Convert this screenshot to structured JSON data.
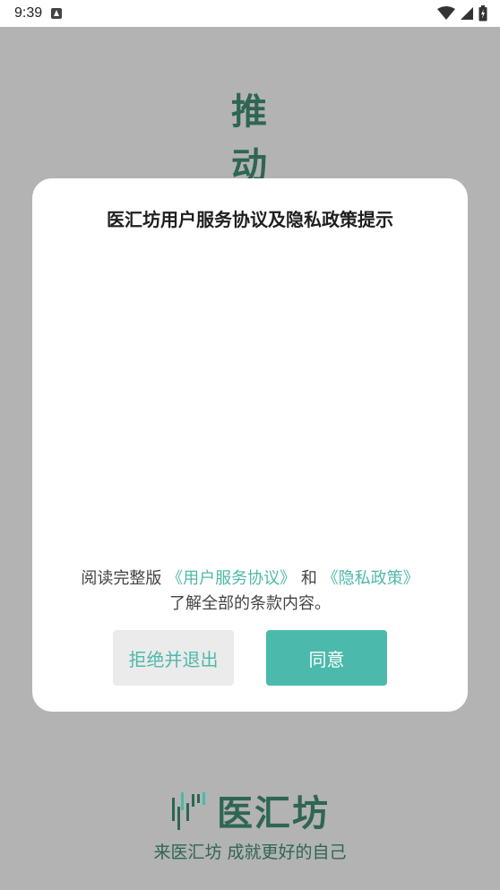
{
  "status_bar": {
    "time": "9:39"
  },
  "background": {
    "calligraphy": [
      "推",
      "动"
    ]
  },
  "dialog": {
    "title": "医汇坊用户服务协议及隐私政策提示",
    "read_prefix": "阅读完整版",
    "user_agreement_link": "《用户服务协议》",
    "and_text": "和",
    "privacy_link": "《隐私政策》",
    "read_suffix": "了解全部的条款内容。",
    "refuse_button": "拒绝并退出",
    "agree_button": "同意"
  },
  "brand": {
    "name": "医汇坊",
    "slogan": "来医汇坊 成就更好的自己"
  },
  "colors": {
    "accent": "#4bb9ab",
    "brand_green": "#2e6652",
    "overlay": "#b3b3b3"
  }
}
